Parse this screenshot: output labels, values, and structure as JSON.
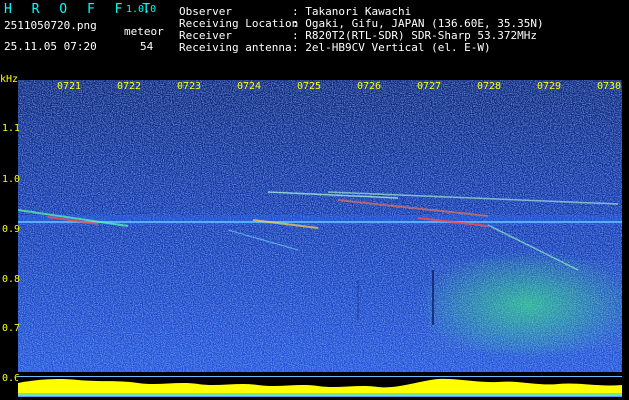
{
  "app": {
    "title": "H R O F F T",
    "version": "1.0.0"
  },
  "file": {
    "name": "2511050720.png",
    "datetime": "25.11.05 07:20"
  },
  "counter": {
    "label": "meteor",
    "value": "54"
  },
  "info": [
    {
      "key": "Observer",
      "value": ": Takanori Kawachi"
    },
    {
      "key": "Receiving Location",
      "value": ": Ogaki, Gifu, JAPAN (136.60E, 35.35N)"
    },
    {
      "key": "Receiver",
      "value": ": R820T2(RTL-SDR) SDR-Sharp 53.372MHz"
    },
    {
      "key": "Receiving antenna",
      "value": ": 2el-HB9CV Vertical (el. E-W)"
    }
  ],
  "axis": {
    "y_unit": "kHz",
    "y_labels": [
      "1.1",
      "1.0",
      "0.9",
      "0.8",
      "0.7",
      "0.6"
    ],
    "x_labels": [
      "0721",
      "0722",
      "0723",
      "0724",
      "0725",
      "0726",
      "0727",
      "0728",
      "0729",
      "0730"
    ]
  },
  "colors": {
    "title": "#00ffff",
    "text": "#ffffff",
    "label": "#ffff00",
    "background": "#000000",
    "spectrogram_base": "#0a2a8c"
  }
}
